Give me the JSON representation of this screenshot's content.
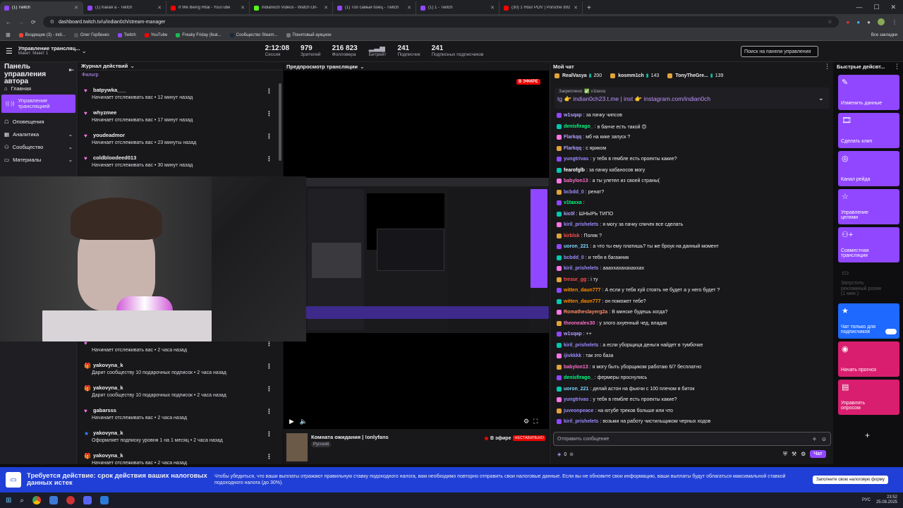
{
  "browser": {
    "tabs": [
      {
        "label": "(1) Twitch",
        "color": "#9147ff",
        "active": true
      },
      {
        "label": "(1) Какая а - Twitch",
        "color": "#9147ff"
      },
      {
        "label": "If We Being Rital - YouTube",
        "color": "#ff0000"
      },
      {
        "label": "indianoch Videos - Watch On-",
        "color": "#53fc18"
      },
      {
        "label": "(1) Топ самый боец - Twitch",
        "color": "#9147ff"
      },
      {
        "label": "(1) 1 - Twitch",
        "color": "#9147ff"
      },
      {
        "label": "(30) 1 Hour POV | Porsche 992",
        "color": "#ff0000"
      }
    ],
    "url": "dashboard.twitch.tv/u/indian0ch/stream-manager",
    "bookmarks": [
      {
        "label": "Входящие (3) - indi...",
        "color": "#ea4335"
      },
      {
        "label": "Олег Горбенко",
        "color": "#555"
      },
      {
        "label": "Twitch",
        "color": "#9147ff"
      },
      {
        "label": "YouTube",
        "color": "#ff0000"
      },
      {
        "label": "Freaky Friday (feat...",
        "color": "#1db954"
      },
      {
        "label": "Сообщество Steam...",
        "color": "#1b2838"
      },
      {
        "label": "Понятовый аукцион",
        "color": "#777"
      }
    ],
    "all_bookmarks": "Все закладки"
  },
  "topnav": {
    "title": "Управление трансляц...",
    "subtitle": "Макет: Макет 1",
    "stats": [
      {
        "value": "2:12:08",
        "label": "Сессия"
      },
      {
        "value": "979",
        "label": "Зрителей"
      },
      {
        "value": "216 823",
        "label": "Фолловера"
      },
      {
        "value": "",
        "label": "Битрейт"
      },
      {
        "value": "241",
        "label": "Подписчик"
      },
      {
        "value": "241",
        "label": "Подписчик"
      },
      {
        "value": "241",
        "label": "Подписчик"
      }
    ],
    "stat_session": "2:12:08",
    "stat_session_label": "Сессия",
    "stat_viewers": "979",
    "stat_viewers_label": "Зрителей",
    "stat_followers": "216 823",
    "stat_followers_label": "Фолловера",
    "stat_bitrate_label": "Битрейт",
    "stat_subs": "241",
    "stat_subs_label": "Подписчик",
    "stat_gift": "241 ",
    "stat_gift_label": "Подписчик",
    "stat_paid": "241",
    "stat_paid_label": "Подписчик",
    "search_placeholder": "Поиск на панели управления",
    "notif_count": "1"
  },
  "sidebar": {
    "title": "Панель управления автора",
    "items": [
      {
        "label": "Главная"
      },
      {
        "label": "Управление трансляцией"
      },
      {
        "label": "Оповещения"
      },
      {
        "label": "Аналитика"
      },
      {
        "label": "Сообщество"
      },
      {
        "label": "Материалы"
      }
    ]
  },
  "activity": {
    "header": "Журнал действий",
    "filter": "Фильтр",
    "events": [
      {
        "user": "batpywka___",
        "text": "Начинает отслеживать вас • 12 минут назад"
      },
      {
        "user": "whyzmee",
        "text": "Начинает отслеживать вас • 17 минут назад"
      },
      {
        "user": "youdeadmor",
        "text": "Начинает отслеживать вас • 23 минуты назад"
      },
      {
        "user": "coldbloodeed013",
        "text": "Начинает отслеживать вас • 30 минут назад"
      },
      {
        "user": "",
        "text": "Начинает отслеживать вас • 2 часа назад"
      },
      {
        "user": "yakovyna_k",
        "text": "Дарит сообществу 10 подарочных подписок • 2 часа назад"
      },
      {
        "user": "yakovyna_k",
        "text": "Дарит сообществу 10 подарочных подписок • 2 часа назад"
      },
      {
        "user": "gabarsss",
        "text": "Начинает отслеживать вас • 2 часа назад"
      },
      {
        "user": "yakovyna_k",
        "text": "Оформляет подписку уровня 1 на 1 месяц • 2 часа назад"
      },
      {
        "user": "yakovyna_k",
        "text": "Начинает отслеживать вас • 2 часа назад"
      }
    ]
  },
  "preview": {
    "header": "Предпросмотр трансляции",
    "live_badge": "В ЭФИРЕ",
    "stream_title": "Комната ожидания | !onlyfans",
    "language": "Русский",
    "status": "В эфире",
    "stability": "НЕСТАБИЛЬНО"
  },
  "chat": {
    "header": "Мой чат",
    "top_viewers": [
      {
        "name": "RealVasya",
        "count": "200"
      },
      {
        "name": "kosmm1ch",
        "count": "143"
      },
      {
        "name": "TonyTheGre...",
        "count": "139"
      }
    ],
    "pinned_label": "Закреплено: ✅ v1taxxa",
    "pinned_text": "tg 👉 indian0ch23.t.me | inst 👉 instagram.com/indian0ch",
    "messages": [
      {
        "user": "w1sqap",
        "color": "#b3a1ff",
        "text": "за пачку чипсов"
      },
      {
        "user": "denisfirago_",
        "color": "#00ff7f",
        "text": "в банче есть такой 😊"
      },
      {
        "user": "Flarkqq",
        "color": "#b3a1ff",
        "text": "мб на кике запуск ?"
      },
      {
        "user": "Flarkqq",
        "color": "#b3a1ff",
        "text": "с яриком"
      },
      {
        "user": "yungtrivas",
        "color": "#9b8cff",
        "text": "у тебя в гембле есть проекты какие?"
      },
      {
        "user": "fearofglb",
        "color": "#ffffff",
        "text": "за пачку кабаносов могу"
      },
      {
        "user": "babylon13",
        "color": "#ff6ec7",
        "text": "а ты улетел из своей страны("
      },
      {
        "user": "bcbdd_0",
        "color": "#9b8cff",
        "text": "ренат?"
      },
      {
        "user": "v1taxxa",
        "color": "#00ff7f",
        "text": ""
      },
      {
        "user": "kic0l",
        "color": "#b3a1ff",
        "text": "ШНЫРЬ ТИПО"
      },
      {
        "user": "kiril_prishelets",
        "color": "#9b8cff",
        "text": "я могу за пачку спичек все сделать"
      },
      {
        "user": "kirblsk",
        "color": "#ff4d4d",
        "text": "Поляк ?"
      },
      {
        "user": "uoron_221",
        "color": "#7fd3ff",
        "text": "а что ты ему платишь? ты же броук на данный момент"
      },
      {
        "user": "bcbdd_0",
        "color": "#9b8cff",
        "text": "и тебя в багажник"
      },
      {
        "user": "kiril_prishelets",
        "color": "#9b8cff",
        "text": "аааххахахахаххах"
      },
      {
        "user": "tresur_gg",
        "color": "#ff4d4d",
        "text": "і ту"
      },
      {
        "user": "witten_daun777",
        "color": "#ff8c00",
        "text": "А если у тебя хуй стоять не будет а у него будет ?"
      },
      {
        "user": "witten_daun777",
        "color": "#ff8c00",
        "text": "он поможет тебе?"
      },
      {
        "user": "Romatheslayerg2a",
        "color": "#ff8c66",
        "text": "В минске будешь когда?"
      },
      {
        "user": "theonealex30",
        "color": "#ff6ec7",
        "text": "у злого ахуенный чед, владик"
      },
      {
        "user": "w1sqap",
        "color": "#b3a1ff",
        "text": "++"
      },
      {
        "user": "kiril_prishelets",
        "color": "#9b8cff",
        "text": "а если уборщица деньги найдет в тумбочке"
      },
      {
        "user": "ijivkkkk",
        "color": "#9b8cff",
        "text": "так это база"
      },
      {
        "user": "babylon13",
        "color": "#ff6ec7",
        "text": "я могу быть уборщиком работаю 6/7 бесплатно"
      },
      {
        "user": "denisfirago_",
        "color": "#00ff7f",
        "text": "фермеры проснулись"
      },
      {
        "user": "uoron_221",
        "color": "#7fd3ff",
        "text": "делай астон на фьючи с 100 плечом в биток"
      },
      {
        "user": "yungtrivas",
        "color": "#9b8cff",
        "text": "у тебя в гембле есть проекты какие?"
      },
      {
        "user": "juveonpeace",
        "color": "#9b8cff",
        "text": "на ютубе треков больше или что"
      },
      {
        "user": "kiril_prishelets",
        "color": "#9b8cff",
        "text": "возьми на работу чистильщиком черных ходов"
      }
    ],
    "input_placeholder": "Отправить сообщение",
    "points": "0",
    "send_label": "Чат"
  },
  "quick_actions": {
    "header": "Быстрые дейсвт...",
    "items": [
      {
        "label": "Изменить данные",
        "style": "purple"
      },
      {
        "label": "Сделать клип",
        "style": "purple"
      },
      {
        "label": "Канал рейда",
        "style": "purple"
      },
      {
        "label": "Управление целями",
        "style": "purple"
      },
      {
        "label": "Совместная трансляция",
        "style": "purple"
      },
      {
        "label": "Запустить рекламный ролик (1 мин.)",
        "style": "disabled"
      },
      {
        "label": "Чат только для подписчиков",
        "style": "blue"
      },
      {
        "label": "Начать прогноз",
        "style": "pink"
      },
      {
        "label": "Управлять опросом",
        "style": "pink"
      }
    ],
    "add": "+"
  },
  "banner": {
    "title": "Требуется действие: срок действия ваших налоговых данных истек",
    "text": "Чтобы убедиться, что ваши выплаты отражают правильную ставку подоходного налога, вам необходимо повторно отправить свои налоговые данные. Если вы не обновите свои информацию, ваши выплаты будут облагаться максимальной ставкой подоходного налога (до 30%).",
    "button": "Заполните свою налоговую форму"
  },
  "taskbar": {
    "lang": "РУС",
    "time": "23:52",
    "date": "25.08.2025"
  }
}
